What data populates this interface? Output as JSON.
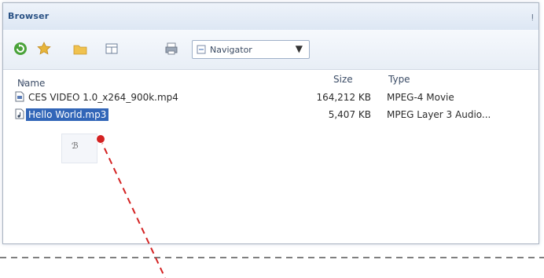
{
  "panel": {
    "title": "Browser",
    "pin_glyph": "ⵑ"
  },
  "toolbar": {
    "buttons": [
      {
        "name": "refresh-button",
        "icon": "refresh-icon"
      },
      {
        "name": "favorites-button",
        "icon": "star-icon"
      },
      {
        "name": "open-folder-button",
        "icon": "folder-icon"
      },
      {
        "name": "view-button",
        "icon": "grid-view-icon"
      },
      {
        "name": "print-button",
        "icon": "printer-icon"
      }
    ],
    "navigator_label": "Navigator",
    "navigator_arrow": "▼"
  },
  "list": {
    "columns": {
      "name": "Name",
      "size": "Size",
      "type": "Type"
    },
    "rows": [
      {
        "name": "CES VIDEO 1.0_x264_900k.mp4",
        "size": "164,212 KB",
        "type": "MPEG-4 Movie",
        "selected": false
      },
      {
        "name": "Hello World.mp3",
        "size": "5,407 KB",
        "type": "MPEG Layer 3 Audio...",
        "selected": true
      }
    ]
  },
  "tooltip": {
    "text": "ℬ"
  },
  "colors": {
    "accent": "#3266b8",
    "marker": "#d42222",
    "title": "#2a5285"
  }
}
